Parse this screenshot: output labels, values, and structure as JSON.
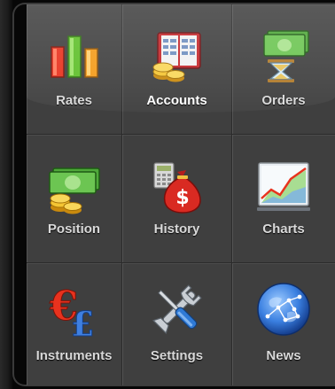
{
  "menu": {
    "items": [
      {
        "label": "Rates",
        "icon": "bar-chart-icon"
      },
      {
        "label": "Accounts",
        "icon": "ledger-coins-icon",
        "active": true
      },
      {
        "label": "Orders",
        "icon": "hourglass-money-icon"
      },
      {
        "label": "Position",
        "icon": "money-coins-icon"
      },
      {
        "label": "History",
        "icon": "money-bag-icon"
      },
      {
        "label": "Charts",
        "icon": "line-chart-icon"
      },
      {
        "label": "Instruments",
        "icon": "currency-symbols-icon"
      },
      {
        "label": "Settings",
        "icon": "tools-icon"
      },
      {
        "label": "News",
        "icon": "globe-icon"
      }
    ]
  },
  "colors": {
    "panel": "#3f3f3f",
    "label": "#d9d9d9",
    "label_active": "#ffffff",
    "divider": "#2b2b2b"
  }
}
